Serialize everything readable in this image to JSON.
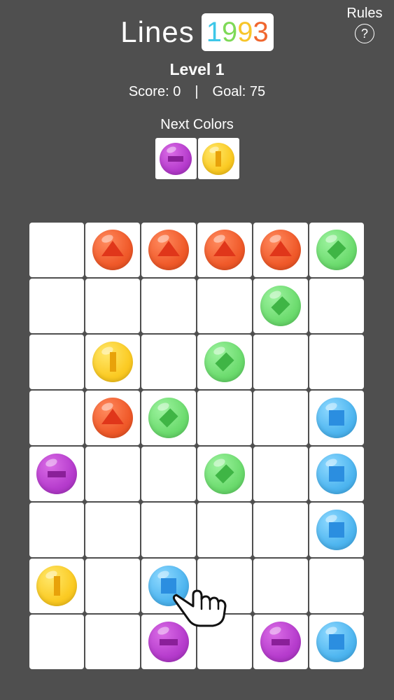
{
  "header": {
    "title_word": "Lines",
    "year_digits": [
      {
        "char": "1",
        "color": "#3ec7e8"
      },
      {
        "char": "9",
        "color": "#7ed957"
      },
      {
        "char": "9",
        "color": "#f7c52a"
      },
      {
        "char": "3",
        "color": "#f0662e"
      }
    ],
    "rules_label": "Rules",
    "rules_icon_char": "?"
  },
  "status": {
    "level": "Level 1",
    "score": "Score: 0",
    "separator": "|",
    "goal": "Goal: 75"
  },
  "next": {
    "label": "Next Colors",
    "balls": [
      {
        "color": "purple",
        "shape": "bar-h"
      },
      {
        "color": "yellow",
        "shape": "bar-v"
      }
    ]
  },
  "board": {
    "rows": 8,
    "cols": 6,
    "cells": [
      [
        null,
        "red",
        "red",
        "red",
        "red",
        "green"
      ],
      [
        null,
        null,
        null,
        null,
        "green",
        null
      ],
      [
        null,
        "yellow",
        null,
        "green",
        null,
        null
      ],
      [
        null,
        "red",
        "green",
        null,
        null,
        "blue"
      ],
      [
        "purple",
        null,
        null,
        "green",
        null,
        "blue"
      ],
      [
        null,
        null,
        null,
        null,
        null,
        "blue"
      ],
      [
        "yellow",
        null,
        "blue",
        null,
        null,
        null
      ],
      [
        null,
        null,
        "purple",
        null,
        "purple",
        "blue"
      ]
    ]
  },
  "ball_shapes": {
    "red": "triangle",
    "green": "diamond",
    "yellow": "bar-v",
    "blue": "square",
    "purple": "bar-h"
  },
  "pointer": {
    "icon": "hand-pointer-icon",
    "row": 6,
    "col": 2
  }
}
